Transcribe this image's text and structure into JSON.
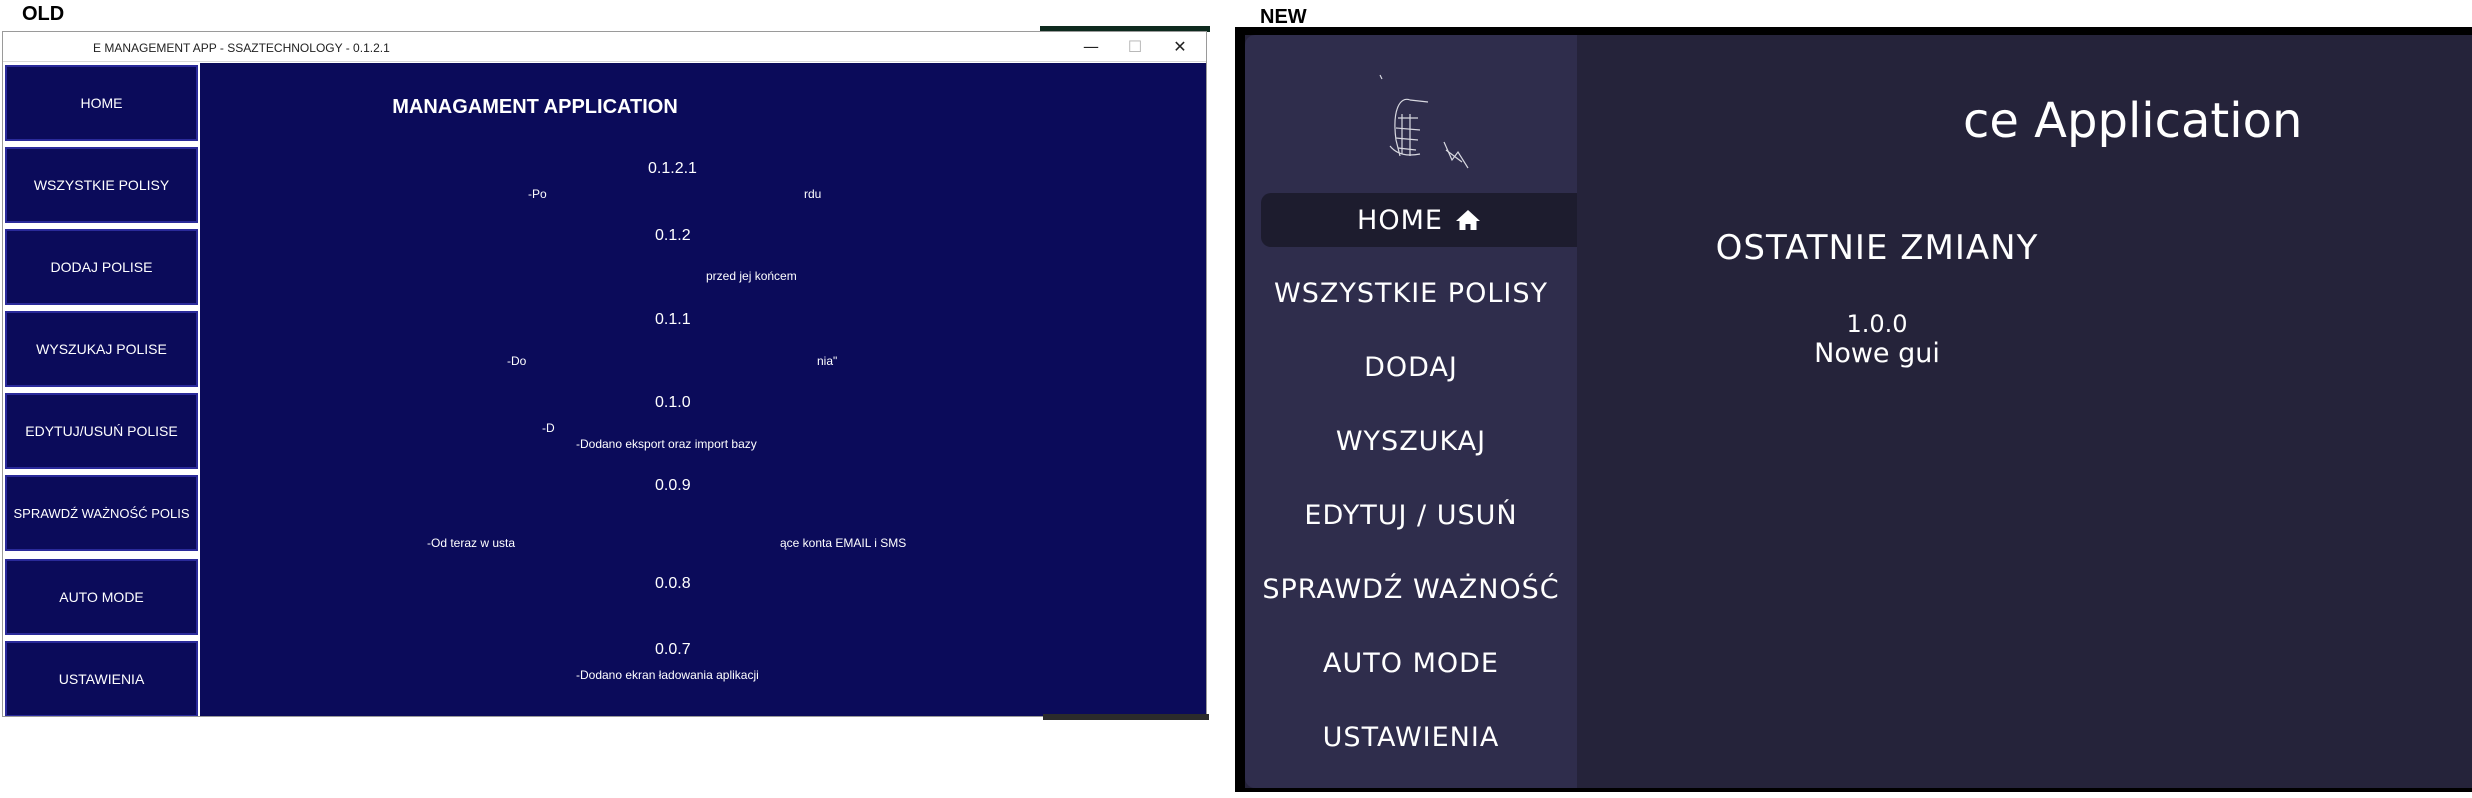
{
  "labels": {
    "old": "OLD",
    "new": "NEW"
  },
  "old": {
    "window_title": "E MANAGEMENT APP - SSAZTECHNOLOGY - 0.1.2.1",
    "window_controls": {
      "minimize": "—",
      "maximize": "☐",
      "close": "✕"
    },
    "nav": [
      {
        "label": "HOME"
      },
      {
        "label": "WSZYSTKIE POLISY"
      },
      {
        "label": "DODAJ POLISE"
      },
      {
        "label": "WYSZUKAJ POLISE"
      },
      {
        "label": "EDYTUJ/USUŃ POLISE"
      },
      {
        "label": "SPRAWDŹ WAŻNOŚĆ POLIS"
      },
      {
        "label": "AUTO MODE"
      },
      {
        "label": "USTAWIENIA"
      }
    ],
    "heading": "MANAGAMENT APPLICATION",
    "changelog": [
      {
        "version": "0.1.2.1",
        "notes": [
          "-Po",
          "rdu"
        ]
      },
      {
        "version": "0.1.2",
        "notes": [
          "przed jej końcem"
        ]
      },
      {
        "version": "0.1.1",
        "notes": [
          "-Do",
          "nia\""
        ]
      },
      {
        "version": "0.1.0",
        "notes": [
          "-D",
          "-Dodano eksport oraz import bazy"
        ]
      },
      {
        "version": "0.0.9",
        "notes": [
          "-Od teraz w usta",
          "ące konta EMAIL i SMS"
        ]
      },
      {
        "version": "0.0.8",
        "notes": []
      },
      {
        "version": "0.0.7",
        "notes": [
          "-Dodano ekran ładowania aplikacji"
        ]
      }
    ]
  },
  "new": {
    "nav": [
      {
        "label": "HOME",
        "icon": "home-icon"
      },
      {
        "label": "WSZYSTKIE POLISY"
      },
      {
        "label": "DODAJ"
      },
      {
        "label": "WYSZUKAJ"
      },
      {
        "label": "EDYTUJ / USUŃ"
      },
      {
        "label": "SPRAWDŹ WAŻNOŚĆ"
      },
      {
        "label": "AUTO MODE"
      },
      {
        "label": "USTAWIENIA"
      }
    ],
    "app_title": "ce Application",
    "changes_title": "OSTATNIE ZMIANY",
    "latest_version": "1.0.0",
    "latest_note": "Nowe gui"
  },
  "colors": {
    "old_background": "#0b0b5a",
    "old_button_border": "#2a2a9a",
    "new_background": "#25233a",
    "new_sidebar": "#2f2d4c",
    "new_active": "#1d1c2e"
  }
}
